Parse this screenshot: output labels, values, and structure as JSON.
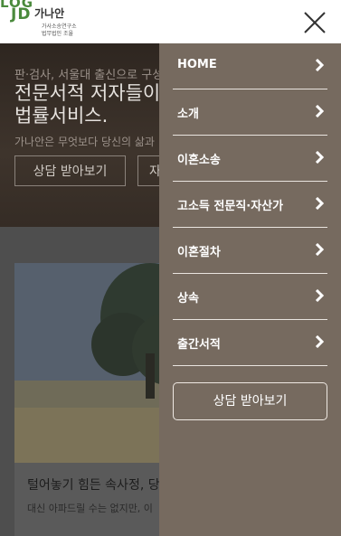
{
  "header": {
    "logo_mark_top": "LOG",
    "logo_mark_bottom": "JD",
    "logo_name": "가나안",
    "logo_sub1": "가사소송연구소",
    "logo_sub2": "법무법인 조율",
    "close_icon": "close-icon"
  },
  "hero": {
    "subtitle": "판·검사, 서울대 출신으로 구성",
    "title_line1": "전문서적 저자들이",
    "title_line2": "법률서비스.",
    "description": "가나안은 무엇보다 당신의 삶과",
    "primary_button": "상담 받아보기",
    "secondary_button": "자"
  },
  "card": {
    "title": "털어놓기 힘든 속사정, 당",
    "description": "대신 아파드릴 수는 없지만, 이"
  },
  "menu": {
    "items": [
      {
        "label": "HOME"
      },
      {
        "label": "소개"
      },
      {
        "label": "이혼소송"
      },
      {
        "label": "고소득 전문직·자산가"
      },
      {
        "label": "이혼절차"
      },
      {
        "label": "상속"
      },
      {
        "label": "출간서적"
      }
    ],
    "consult_button": "상담 받아보기",
    "background_color": "#766a5f"
  }
}
